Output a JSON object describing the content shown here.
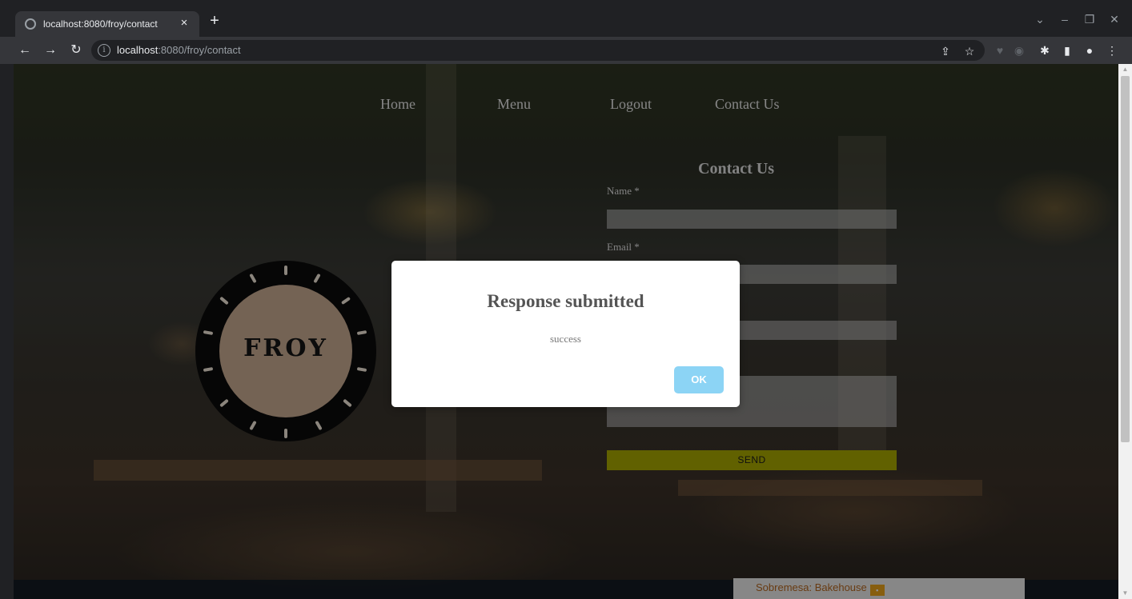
{
  "browser": {
    "tab_title": "localhost:8080/froy/contact",
    "tab_close": "×",
    "new_tab": "+",
    "url_host": "localhost",
    "url_rest": ":8080/froy/contact",
    "icons": [
      "back-icon",
      "forward-icon",
      "reload-icon",
      "site-info-icon",
      "share-icon",
      "star-icon",
      "extensions-icon",
      "side-panel-icon",
      "profile-icon",
      "menu-icon"
    ]
  },
  "nav": {
    "home": "Home",
    "menu": "Menu",
    "logout": "Logout",
    "contact": "Contact Us"
  },
  "logo": {
    "text": "FROY"
  },
  "form": {
    "title": "Contact Us",
    "name_label": "Name *",
    "email_label": "Email *",
    "send_label": "SEND"
  },
  "footer": {
    "card_text": "Sobremesa: Bakehouse"
  },
  "modal": {
    "title": "Response submitted",
    "message": "success",
    "ok_label": "OK"
  },
  "colors": {
    "send_button": "#a8a800",
    "ok_button": "#8cd4f5",
    "logo_inner": "#c9ab91"
  }
}
